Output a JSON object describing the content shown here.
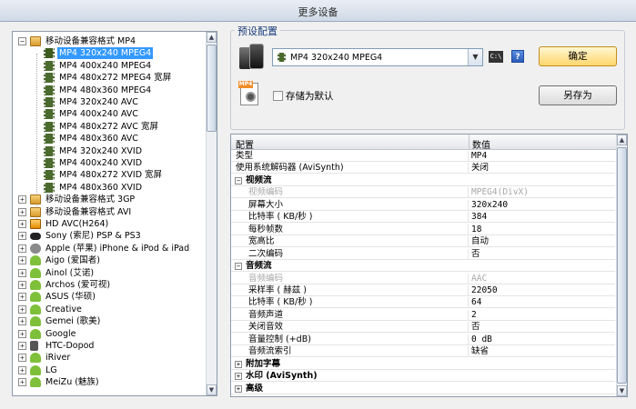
{
  "window": {
    "title": "更多设备"
  },
  "tree": {
    "items": [
      {
        "label": "移动设备兼容格式 MP4",
        "level": 0,
        "expander": "−",
        "icon": "folder-icon",
        "expanded": true
      },
      {
        "label": "MP4 320x240 MPEG4",
        "level": 1,
        "icon": "film-icon",
        "selected": true
      },
      {
        "label": "MP4 400x240 MPEG4",
        "level": 1,
        "icon": "film-icon"
      },
      {
        "label": "MP4 480x272 MPEG4 宽屏",
        "level": 1,
        "icon": "film-icon"
      },
      {
        "label": "MP4 480x360 MPEG4",
        "level": 1,
        "icon": "film-icon"
      },
      {
        "label": "MP4 320x240 AVC",
        "level": 1,
        "icon": "film-icon"
      },
      {
        "label": "MP4 400x240 AVC",
        "level": 1,
        "icon": "film-icon"
      },
      {
        "label": "MP4 480x272 AVC 宽屏",
        "level": 1,
        "icon": "film-icon"
      },
      {
        "label": "MP4 480x360 AVC",
        "level": 1,
        "icon": "film-icon"
      },
      {
        "label": "MP4 320x240 XVID",
        "level": 1,
        "icon": "film-icon"
      },
      {
        "label": "MP4 400x240 XVID",
        "level": 1,
        "icon": "film-icon"
      },
      {
        "label": "MP4 480x272 XVID 宽屏",
        "level": 1,
        "icon": "film-icon"
      },
      {
        "label": "MP4 480x360 XVID",
        "level": 1,
        "icon": "film-icon"
      },
      {
        "label": "移动设备兼容格式 3GP",
        "level": 0,
        "expander": "+",
        "icon": "folder-icon"
      },
      {
        "label": "移动设备兼容格式 AVI",
        "level": 0,
        "expander": "+",
        "icon": "folder-icon"
      },
      {
        "label": "HD AVC(H264)",
        "level": 0,
        "expander": "+",
        "icon": "hd-icon"
      },
      {
        "label": "Sony (索尼) PSP & PS3",
        "level": 0,
        "expander": "+",
        "icon": "psp-icon"
      },
      {
        "label": "Apple (苹果) iPhone & iPod & iPad",
        "level": 0,
        "expander": "+",
        "icon": "apple-icon"
      },
      {
        "label": "Aigo (爱国者)",
        "level": 0,
        "expander": "+",
        "icon": "android-icon"
      },
      {
        "label": "Ainol (艾诺)",
        "level": 0,
        "expander": "+",
        "icon": "android-icon"
      },
      {
        "label": "Archos (爱可视)",
        "level": 0,
        "expander": "+",
        "icon": "android-icon"
      },
      {
        "label": "ASUS (华硕)",
        "level": 0,
        "expander": "+",
        "icon": "android-icon"
      },
      {
        "label": "Creative",
        "level": 0,
        "expander": "+",
        "icon": "android-icon"
      },
      {
        "label": "Gemei (歌美)",
        "level": 0,
        "expander": "+",
        "icon": "android-icon"
      },
      {
        "label": "Google",
        "level": 0,
        "expander": "+",
        "icon": "android-icon"
      },
      {
        "label": "HTC-Dopod",
        "level": 0,
        "expander": "+",
        "icon": "phone-icon"
      },
      {
        "label": "iRiver",
        "level": 0,
        "expander": "+",
        "icon": "android-icon"
      },
      {
        "label": "LG",
        "level": 0,
        "expander": "+",
        "icon": "android-icon"
      },
      {
        "label": "MeiZu (魅族)",
        "level": 0,
        "expander": "+",
        "icon": "android-icon"
      }
    ]
  },
  "preset": {
    "group_label": "预设配置",
    "selected": "MP4 320x240 MPEG4",
    "cmd_label": "C:\\",
    "help_label": "?",
    "ok_label": "确定",
    "save_default_label": "存储为默认",
    "save_as_label": "另存为",
    "mp4_badge": "MP4"
  },
  "grid": {
    "col_key": "配置",
    "col_value": "数值",
    "rows": [
      {
        "type": "prop",
        "k": "类型",
        "v": "MP4"
      },
      {
        "type": "prop",
        "k": "使用系统解码器 (AviSynth)",
        "v": "关闭"
      },
      {
        "type": "cat",
        "k": "视频流",
        "exp": "−"
      },
      {
        "type": "sub",
        "k": "视频编码",
        "v": "MPEG4(DivX)",
        "disabled": true
      },
      {
        "type": "sub",
        "k": "屏幕大小",
        "v": "320x240"
      },
      {
        "type": "sub",
        "k": "比特率 ( KB/秒 )",
        "v": "384"
      },
      {
        "type": "sub",
        "k": "每秒帧数",
        "v": "18"
      },
      {
        "type": "sub",
        "k": "宽高比",
        "v": "自动"
      },
      {
        "type": "sub",
        "k": "二次编码",
        "v": "否"
      },
      {
        "type": "cat",
        "k": "音频流",
        "exp": "−"
      },
      {
        "type": "sub",
        "k": "音频编码",
        "v": "AAC",
        "disabled": true
      },
      {
        "type": "sub",
        "k": "采样率 ( 赫兹 )",
        "v": "22050"
      },
      {
        "type": "sub",
        "k": "比特率 ( KB/秒 )",
        "v": "64"
      },
      {
        "type": "sub",
        "k": "音频声道",
        "v": "2"
      },
      {
        "type": "sub",
        "k": "关闭音效",
        "v": "否"
      },
      {
        "type": "sub",
        "k": "音量控制 (+dB)",
        "v": "0 dB"
      },
      {
        "type": "sub",
        "k": "音频流索引",
        "v": "缺省"
      },
      {
        "type": "cat",
        "k": "附加字幕",
        "exp": "+"
      },
      {
        "type": "cat",
        "k": "水印 (AviSynth)",
        "exp": "+"
      },
      {
        "type": "cat",
        "k": "高级",
        "exp": "+"
      }
    ]
  }
}
